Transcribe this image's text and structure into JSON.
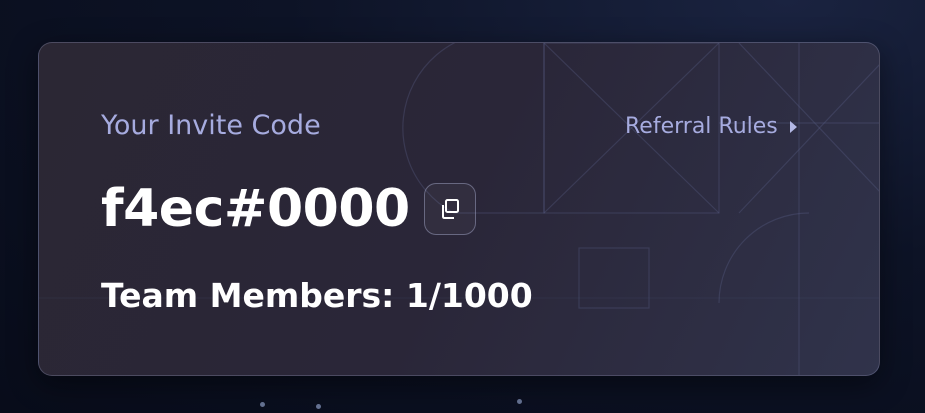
{
  "invite_card": {
    "label": "Your Invite Code",
    "code": "f4ec#0000",
    "copy_icon": "copy-icon",
    "team_members": "Team Members: 1/1000",
    "rules_link": {
      "label": "Referral Rules",
      "icon": "caret-right-icon"
    }
  },
  "colors": {
    "accent_text": "#a6abdf",
    "primary_text": "#ffffff",
    "card_background": "#2b2734",
    "page_background": "#0d1326"
  }
}
